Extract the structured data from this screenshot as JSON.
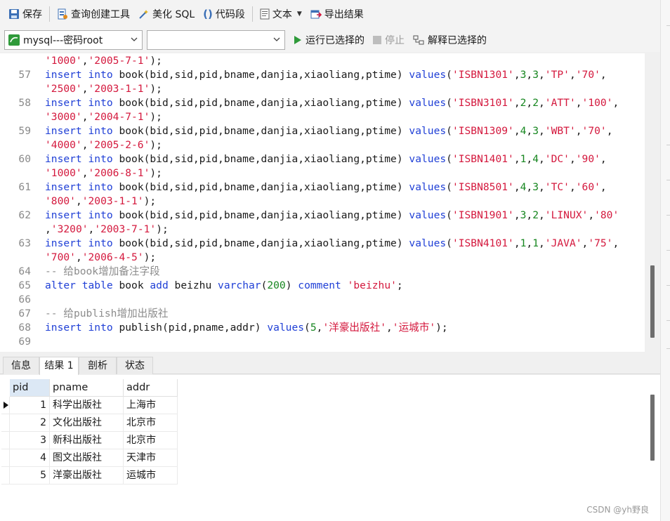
{
  "toolbar": {
    "save": "保存",
    "query_builder": "查询创建工具",
    "beautify_sql": "美化 SQL",
    "code_snippet": "代码段",
    "text": "文本",
    "export_result": "导出结果"
  },
  "toolbar2": {
    "connection": "mysql---密码root",
    "database": "",
    "run_selected": "运行已选择的",
    "stop": "停止",
    "explain_selected": "解释已选择的"
  },
  "editor": {
    "lines": [
      {
        "num": "",
        "tokens": [
          [
            "str",
            "'1000'"
          ],
          [
            "plain",
            ","
          ],
          [
            "str",
            "'2005-7-1'"
          ],
          [
            "plain",
            ");"
          ]
        ]
      },
      {
        "num": "57",
        "tokens": [
          [
            "kw",
            "insert"
          ],
          [
            "plain",
            " "
          ],
          [
            "kw",
            "into"
          ],
          [
            "plain",
            " book(bid,sid,pid,bname,danjia,xiaoliang,ptime) "
          ],
          [
            "kw",
            "values"
          ],
          [
            "plain",
            "("
          ],
          [
            "str",
            "'ISBN1301'"
          ],
          [
            "plain",
            ","
          ],
          [
            "num",
            "3"
          ],
          [
            "plain",
            ","
          ],
          [
            "num",
            "3"
          ],
          [
            "plain",
            ","
          ],
          [
            "str",
            "'TP'"
          ],
          [
            "plain",
            ","
          ],
          [
            "str",
            "'70'"
          ],
          [
            "plain",
            ","
          ]
        ]
      },
      {
        "num": "",
        "tokens": [
          [
            "str",
            "'2500'"
          ],
          [
            "plain",
            ","
          ],
          [
            "str",
            "'2003-1-1'"
          ],
          [
            "plain",
            ");"
          ]
        ]
      },
      {
        "num": "58",
        "tokens": [
          [
            "kw",
            "insert"
          ],
          [
            "plain",
            " "
          ],
          [
            "kw",
            "into"
          ],
          [
            "plain",
            " book(bid,sid,pid,bname,danjia,xiaoliang,ptime) "
          ],
          [
            "kw",
            "values"
          ],
          [
            "plain",
            "("
          ],
          [
            "str",
            "'ISBN3101'"
          ],
          [
            "plain",
            ","
          ],
          [
            "num",
            "2"
          ],
          [
            "plain",
            ","
          ],
          [
            "num",
            "2"
          ],
          [
            "plain",
            ","
          ],
          [
            "str",
            "'ATT'"
          ],
          [
            "plain",
            ","
          ],
          [
            "str",
            "'100'"
          ],
          [
            "plain",
            ","
          ]
        ]
      },
      {
        "num": "",
        "tokens": [
          [
            "str",
            "'3000'"
          ],
          [
            "plain",
            ","
          ],
          [
            "str",
            "'2004-7-1'"
          ],
          [
            "plain",
            ");"
          ]
        ]
      },
      {
        "num": "59",
        "tokens": [
          [
            "kw",
            "insert"
          ],
          [
            "plain",
            " "
          ],
          [
            "kw",
            "into"
          ],
          [
            "plain",
            " book(bid,sid,pid,bname,danjia,xiaoliang,ptime) "
          ],
          [
            "kw",
            "values"
          ],
          [
            "plain",
            "("
          ],
          [
            "str",
            "'ISBN1309'"
          ],
          [
            "plain",
            ","
          ],
          [
            "num",
            "4"
          ],
          [
            "plain",
            ","
          ],
          [
            "num",
            "3"
          ],
          [
            "plain",
            ","
          ],
          [
            "str",
            "'WBT'"
          ],
          [
            "plain",
            ","
          ],
          [
            "str",
            "'70'"
          ],
          [
            "plain",
            ","
          ]
        ]
      },
      {
        "num": "",
        "tokens": [
          [
            "str",
            "'4000'"
          ],
          [
            "plain",
            ","
          ],
          [
            "str",
            "'2005-2-6'"
          ],
          [
            "plain",
            ");"
          ]
        ]
      },
      {
        "num": "60",
        "tokens": [
          [
            "kw",
            "insert"
          ],
          [
            "plain",
            " "
          ],
          [
            "kw",
            "into"
          ],
          [
            "plain",
            " book(bid,sid,pid,bname,danjia,xiaoliang,ptime) "
          ],
          [
            "kw",
            "values"
          ],
          [
            "plain",
            "("
          ],
          [
            "str",
            "'ISBN1401'"
          ],
          [
            "plain",
            ","
          ],
          [
            "num",
            "1"
          ],
          [
            "plain",
            ","
          ],
          [
            "num",
            "4"
          ],
          [
            "plain",
            ","
          ],
          [
            "str",
            "'DC'"
          ],
          [
            "plain",
            ","
          ],
          [
            "str",
            "'90'"
          ],
          [
            "plain",
            ","
          ]
        ]
      },
      {
        "num": "",
        "tokens": [
          [
            "str",
            "'1000'"
          ],
          [
            "plain",
            ","
          ],
          [
            "str",
            "'2006-8-1'"
          ],
          [
            "plain",
            ");"
          ]
        ]
      },
      {
        "num": "61",
        "tokens": [
          [
            "kw",
            "insert"
          ],
          [
            "plain",
            " "
          ],
          [
            "kw",
            "into"
          ],
          [
            "plain",
            " book(bid,sid,pid,bname,danjia,xiaoliang,ptime) "
          ],
          [
            "kw",
            "values"
          ],
          [
            "plain",
            "("
          ],
          [
            "str",
            "'ISBN8501'"
          ],
          [
            "plain",
            ","
          ],
          [
            "num",
            "4"
          ],
          [
            "plain",
            ","
          ],
          [
            "num",
            "3"
          ],
          [
            "plain",
            ","
          ],
          [
            "str",
            "'TC'"
          ],
          [
            "plain",
            ","
          ],
          [
            "str",
            "'60'"
          ],
          [
            "plain",
            ","
          ]
        ]
      },
      {
        "num": "",
        "tokens": [
          [
            "str",
            "'800'"
          ],
          [
            "plain",
            ","
          ],
          [
            "str",
            "'2003-1-1'"
          ],
          [
            "plain",
            ");"
          ]
        ]
      },
      {
        "num": "62",
        "tokens": [
          [
            "kw",
            "insert"
          ],
          [
            "plain",
            " "
          ],
          [
            "kw",
            "into"
          ],
          [
            "plain",
            " book(bid,sid,pid,bname,danjia,xiaoliang,ptime) "
          ],
          [
            "kw",
            "values"
          ],
          [
            "plain",
            "("
          ],
          [
            "str",
            "'ISBN1901'"
          ],
          [
            "plain",
            ","
          ],
          [
            "num",
            "3"
          ],
          [
            "plain",
            ","
          ],
          [
            "num",
            "2"
          ],
          [
            "plain",
            ","
          ],
          [
            "str",
            "'LINUX'"
          ],
          [
            "plain",
            ","
          ],
          [
            "str",
            "'80'"
          ]
        ]
      },
      {
        "num": "",
        "tokens": [
          [
            "plain",
            ","
          ],
          [
            "str",
            "'3200'"
          ],
          [
            "plain",
            ","
          ],
          [
            "str",
            "'2003-7-1'"
          ],
          [
            "plain",
            ");"
          ]
        ]
      },
      {
        "num": "63",
        "tokens": [
          [
            "kw",
            "insert"
          ],
          [
            "plain",
            " "
          ],
          [
            "kw",
            "into"
          ],
          [
            "plain",
            " book(bid,sid,pid,bname,danjia,xiaoliang,ptime) "
          ],
          [
            "kw",
            "values"
          ],
          [
            "plain",
            "("
          ],
          [
            "str",
            "'ISBN4101'"
          ],
          [
            "plain",
            ","
          ],
          [
            "num",
            "1"
          ],
          [
            "plain",
            ","
          ],
          [
            "num",
            "1"
          ],
          [
            "plain",
            ","
          ],
          [
            "str",
            "'JAVA'"
          ],
          [
            "plain",
            ","
          ],
          [
            "str",
            "'75'"
          ],
          [
            "plain",
            ","
          ]
        ]
      },
      {
        "num": "",
        "tokens": [
          [
            "str",
            "'700'"
          ],
          [
            "plain",
            ","
          ],
          [
            "str",
            "'2006-4-5'"
          ],
          [
            "plain",
            ");"
          ]
        ]
      },
      {
        "num": "64",
        "tokens": [
          [
            "cm",
            "-- 给book增加备注字段"
          ]
        ]
      },
      {
        "num": "65",
        "tokens": [
          [
            "kw",
            "alter"
          ],
          [
            "plain",
            " "
          ],
          [
            "kw",
            "table"
          ],
          [
            "plain",
            " book "
          ],
          [
            "kw",
            "add"
          ],
          [
            "plain",
            " beizhu "
          ],
          [
            "kw",
            "varchar"
          ],
          [
            "plain",
            "("
          ],
          [
            "num",
            "200"
          ],
          [
            "plain",
            ") "
          ],
          [
            "kw",
            "comment"
          ],
          [
            "plain",
            " "
          ],
          [
            "str",
            "'beizhu'"
          ],
          [
            "plain",
            ";"
          ]
        ]
      },
      {
        "num": "66",
        "tokens": []
      },
      {
        "num": "67",
        "tokens": [
          [
            "cm",
            "-- 给publish增加出版社"
          ]
        ]
      },
      {
        "num": "68",
        "tokens": [
          [
            "kw",
            "insert"
          ],
          [
            "plain",
            " "
          ],
          [
            "kw",
            "into"
          ],
          [
            "plain",
            " publish(pid,pname,addr) "
          ],
          [
            "kw",
            "values"
          ],
          [
            "plain",
            "("
          ],
          [
            "num",
            "5"
          ],
          [
            "plain",
            ","
          ],
          [
            "str",
            "'洋豪出版社'"
          ],
          [
            "plain",
            ","
          ],
          [
            "str",
            "'运城市'"
          ],
          [
            "plain",
            ");"
          ]
        ]
      },
      {
        "num": "69",
        "tokens": []
      }
    ]
  },
  "tabs": [
    "信息",
    "结果 1",
    "剖析",
    "状态"
  ],
  "active_tab": 1,
  "result": {
    "columns": [
      "pid",
      "pname",
      "addr"
    ],
    "rows": [
      [
        "1",
        "科学出版社",
        "上海市"
      ],
      [
        "2",
        "文化出版社",
        "北京市"
      ],
      [
        "3",
        "新科出版社",
        "北京市"
      ],
      [
        "4",
        "图文出版社",
        "天津市"
      ],
      [
        "5",
        "洋豪出版社",
        "运城市"
      ]
    ]
  },
  "watermark": "CSDN @yh野良",
  "colors": {
    "keyword": "#1f3fd6",
    "string": "#d4183d",
    "number": "#16861f",
    "comment": "#8c8c8c"
  }
}
